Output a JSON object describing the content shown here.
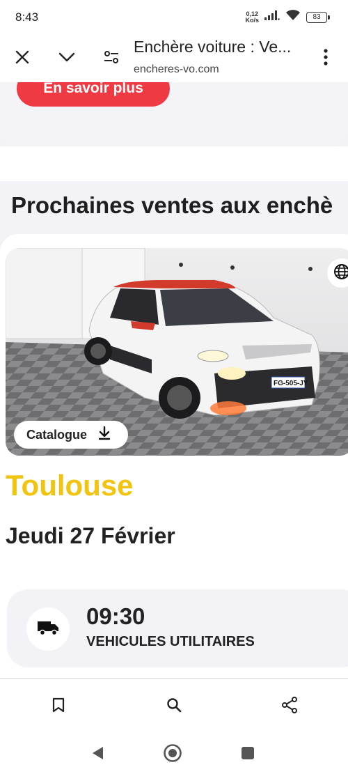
{
  "status_bar": {
    "time": "8:43",
    "net_speed": "0,12",
    "net_unit": "Ko/s",
    "battery": "83"
  },
  "browser": {
    "title": "Enchère voiture : Ve...",
    "url": "encheres-vo.com"
  },
  "promo": {
    "button_label": "En savoir plus"
  },
  "section": {
    "title": "Prochaines ventes aux enchè"
  },
  "sale": {
    "catalogue_label": "Catalogue",
    "plate": "FG-505-JY",
    "city": "Toulouse",
    "date": "Jeudi 27 Février",
    "slot": {
      "time": "09:30",
      "type": "VEHICULES UTILITAIRES"
    }
  },
  "colors": {
    "accent_red": "#f03a43",
    "city_yellow": "#f1c40f",
    "page_bg": "#f3f2f6"
  }
}
